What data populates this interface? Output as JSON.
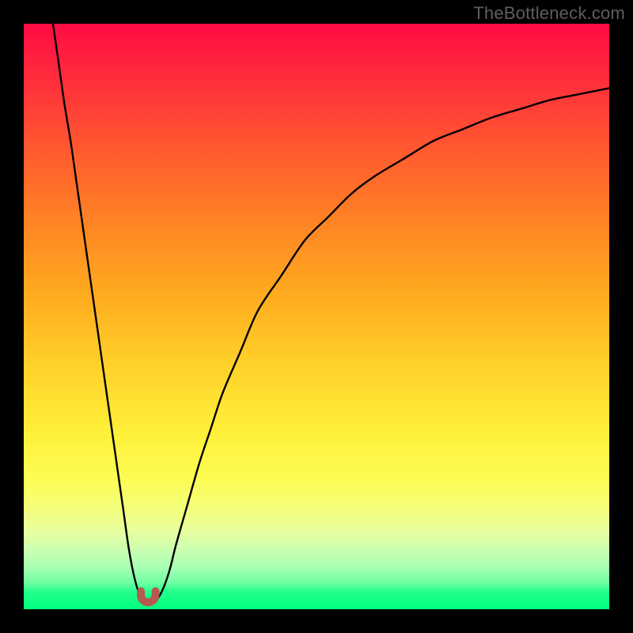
{
  "watermark": "TheBottleneck.com",
  "colors": {
    "frame": "#000000",
    "gradient_top": "#ff0b44",
    "gradient_mid": "#ffe23a",
    "gradient_bottom": "#00ff7f",
    "curve": "#000000",
    "minimum_marker": "#b55a51"
  },
  "chart_data": {
    "type": "line",
    "title": "",
    "xlabel": "",
    "ylabel": "",
    "xlim": [
      0,
      100
    ],
    "ylim": [
      0,
      100
    ],
    "grid": false,
    "legend": false,
    "annotations": [],
    "series": [
      {
        "name": "bottleneck_curve",
        "x": [
          5,
          6,
          7,
          8,
          9,
          10,
          11,
          12,
          13,
          14,
          15,
          16,
          17,
          18,
          19,
          20,
          21,
          22,
          23,
          24,
          25,
          26,
          28,
          30,
          32,
          34,
          37,
          40,
          44,
          48,
          52,
          56,
          60,
          65,
          70,
          75,
          80,
          85,
          90,
          95,
          100
        ],
        "y": [
          100,
          93,
          86,
          80,
          73,
          66,
          59,
          52,
          45,
          38,
          31,
          24,
          17,
          10,
          5,
          2,
          1,
          1,
          2,
          4,
          7,
          11,
          18,
          25,
          31,
          37,
          44,
          51,
          57,
          63,
          67,
          71,
          74,
          77,
          80,
          82,
          84,
          85.5,
          87,
          88,
          89
        ]
      }
    ],
    "minimum_marker": {
      "x_range": [
        20,
        22.5
      ],
      "y": 1.2,
      "shape": "U"
    }
  }
}
